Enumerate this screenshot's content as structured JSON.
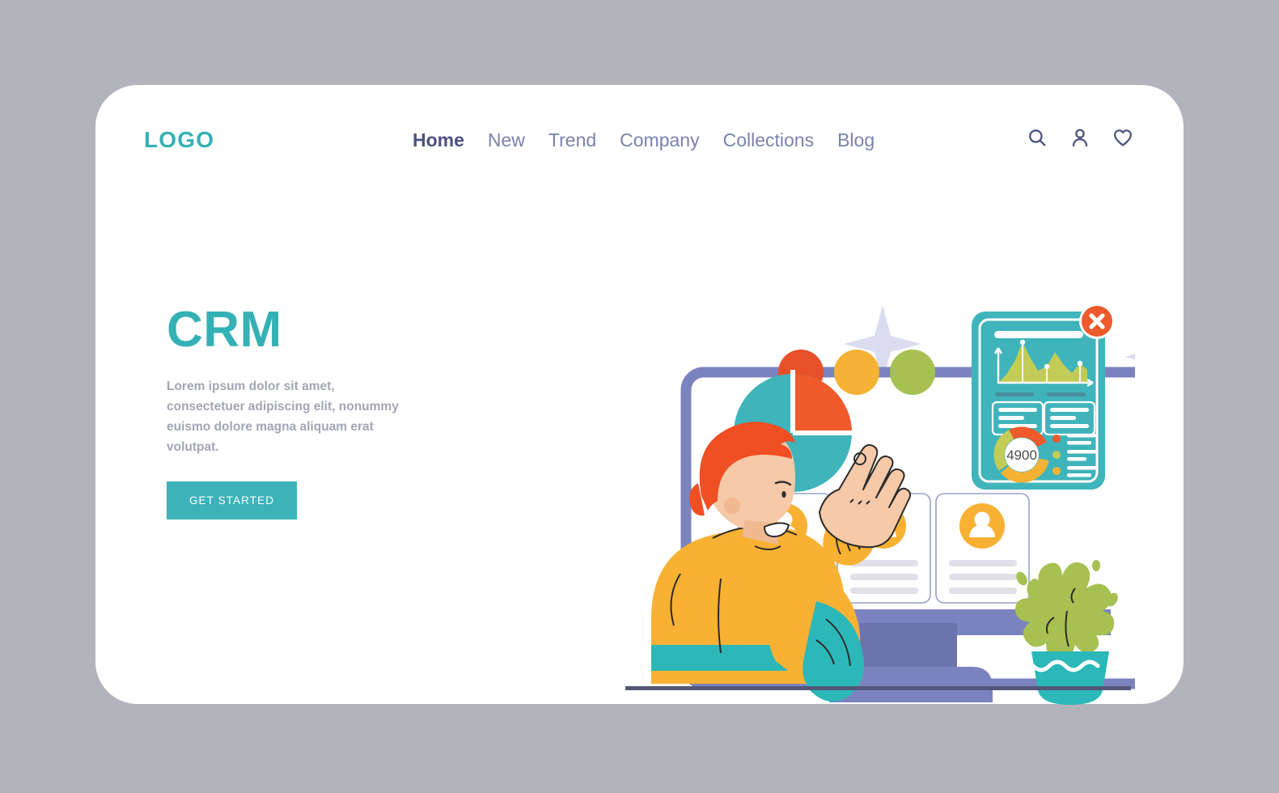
{
  "header": {
    "logo": "LOGO",
    "nav": [
      {
        "label": "Home",
        "active": true
      },
      {
        "label": "New",
        "active": false
      },
      {
        "label": "Trend",
        "active": false
      },
      {
        "label": "Company",
        "active": false
      },
      {
        "label": "Collections",
        "active": false
      },
      {
        "label": "Blog",
        "active": false
      }
    ],
    "icons": [
      "search-icon",
      "user-icon",
      "heart-icon"
    ]
  },
  "hero": {
    "title": "CRM",
    "paragraph": "Lorem ipsum dolor sit amet, consectetuer adipiscing elit, nonummy euismo dolore magna aliquam erat volutpat.",
    "cta_label": "GET STARTED"
  },
  "illustration": {
    "name": "crm-dashboard-illustration",
    "close_badge": "✕",
    "gauge_value": "4900",
    "status_dots": [
      "#e8502a",
      "#f5b234",
      "#a7c052"
    ],
    "pie": {
      "segments": [
        {
          "color": "#3fb4bb",
          "pct": 75
        },
        {
          "color": "#f15a2b",
          "pct": 25
        }
      ]
    },
    "contact_cards": 3
  },
  "colors": {
    "page_background": "#b3b3bb",
    "card_background": "#ffffff",
    "brand_teal": "#34b1b4",
    "nav_inactive": "#7b82ad",
    "nav_active": "#4b5280",
    "body_text": "#a3a6b3",
    "cta_background": "#3bb3b8",
    "monitor_frame": "#7b83bf",
    "accent_orange": "#f15a2b",
    "accent_amber": "#f5b234",
    "accent_olive": "#a7c052",
    "sparkle": "#dcdcf0"
  }
}
